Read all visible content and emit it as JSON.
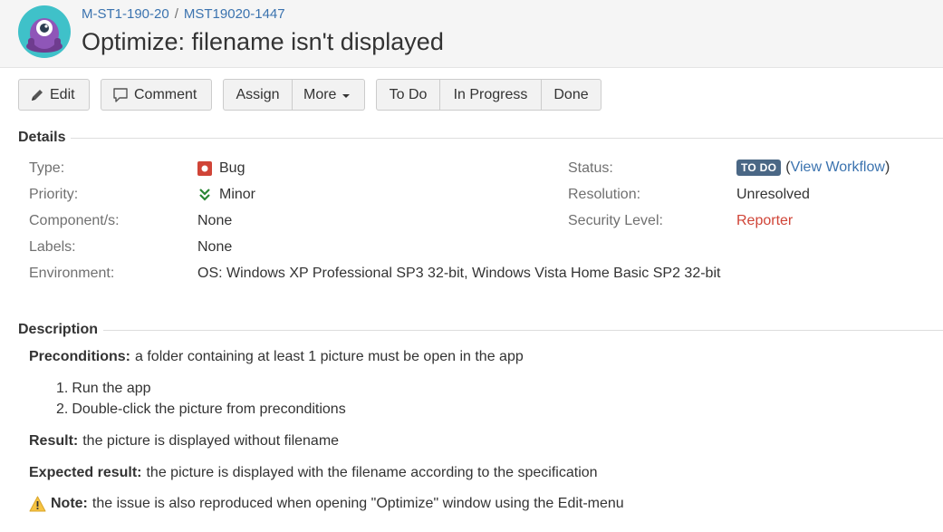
{
  "breadcrumb": {
    "project": "M-ST1-190-20",
    "separator": "/",
    "issue_key": "MST19020-1447"
  },
  "title": "Optimize: filename isn't displayed",
  "toolbar": {
    "edit": "Edit",
    "comment": "Comment",
    "assign": "Assign",
    "more": "More",
    "todo": "To Do",
    "in_progress": "In Progress",
    "done": "Done"
  },
  "details": {
    "heading": "Details",
    "type_label": "Type:",
    "type_value": "Bug",
    "priority_label": "Priority:",
    "priority_value": "Minor",
    "components_label": "Component/s:",
    "components_value": "None",
    "labels_label": "Labels:",
    "labels_value": "None",
    "environment_label": "Environment:",
    "environment_value": "OS: Windows XP Professional SP3 32-bit, Windows Vista Home Basic SP2 32-bit",
    "status_label": "Status:",
    "status_value": "TO DO",
    "workflow_link": "View Workflow",
    "resolution_label": "Resolution:",
    "resolution_value": "Unresolved",
    "security_label": "Security Level:",
    "security_value": "Reporter"
  },
  "description": {
    "heading": "Description",
    "preconditions_label": "Preconditions:",
    "preconditions_text": "a folder containing at least 1 picture must be open in the app",
    "steps": [
      {
        "num": "1.",
        "text": "Run the app"
      },
      {
        "num": "2.",
        "text": "Double-click the picture from preconditions"
      }
    ],
    "result_label": "Result:",
    "result_text": "the picture is displayed without filename",
    "expected_label": "Expected result:",
    "expected_text": "the picture is displayed with the filename according to the specification",
    "note_label": "Note:",
    "note_text": "the issue is also reproduced when opening \"Optimize\" window using the Edit-menu"
  },
  "colors": {
    "link": "#3b73af",
    "status_lozenge": "#4a6785",
    "reporter": "#d04437",
    "bug_icon": "#d04437",
    "minor_icon": "#2a8735",
    "warning_icon": "#f6c342"
  },
  "icons": {
    "avatar": "project-avatar-icon",
    "edit": "pencil-icon",
    "comment": "speech-bubble-icon",
    "type": "bug-icon",
    "priority": "double-chevron-down-icon",
    "note": "warning-icon"
  }
}
